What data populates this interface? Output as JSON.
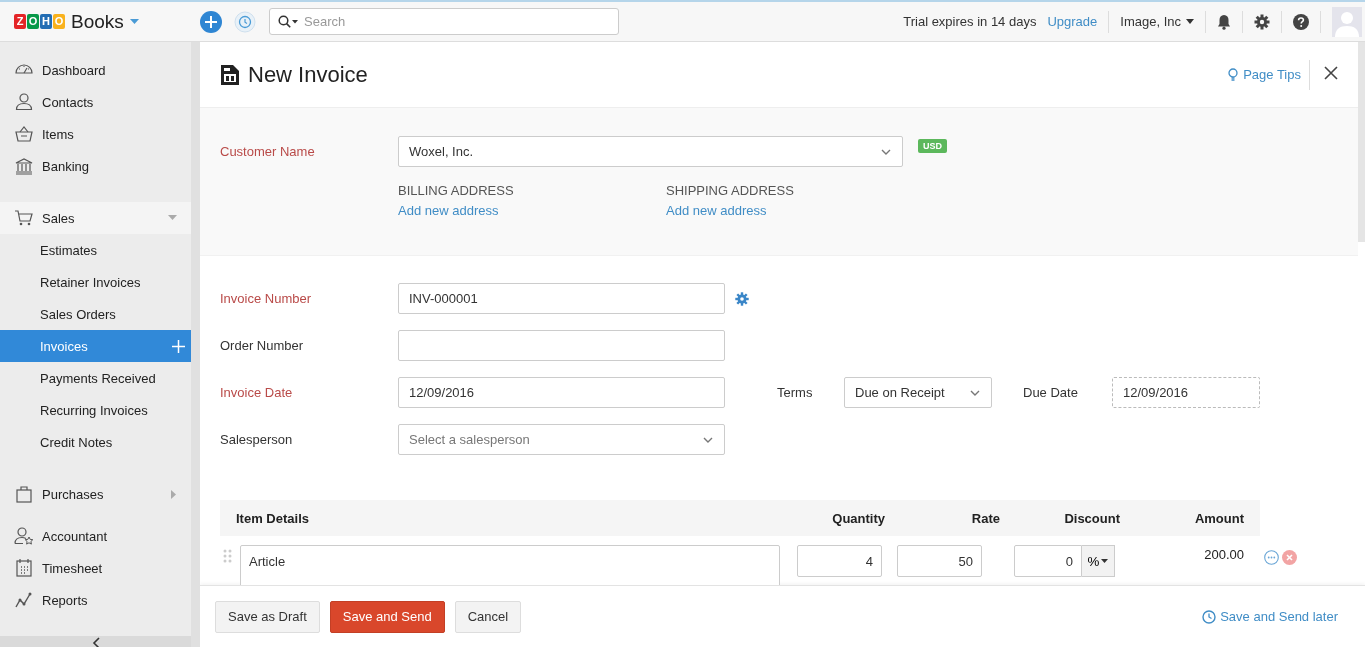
{
  "topbar": {
    "logo": [
      {
        "letter": "Z",
        "color": "#e42527"
      },
      {
        "letter": "O",
        "color": "#089949"
      },
      {
        "letter": "H",
        "color": "#226db4"
      },
      {
        "letter": "O",
        "color": "#f9b21d"
      }
    ],
    "product": "Books",
    "search": {
      "placeholder": "Search"
    },
    "trial": "Trial expires in 14 days",
    "upgrade": "Upgrade",
    "org": "Image, Inc"
  },
  "sidebar": {
    "sections": [
      {
        "items": [
          {
            "label": "Dashboard"
          },
          {
            "label": "Contacts"
          },
          {
            "label": "Items"
          },
          {
            "label": "Banking"
          }
        ]
      },
      {
        "items": [
          {
            "label": "Sales",
            "expanded": true,
            "children": [
              {
                "label": "Estimates",
                "selected": false
              },
              {
                "label": "Retainer Invoices",
                "selected": false
              },
              {
                "label": "Sales Orders",
                "selected": false
              },
              {
                "label": "Invoices",
                "selected": true
              },
              {
                "label": "Payments Received",
                "selected": false
              },
              {
                "label": "Recurring Invoices",
                "selected": false
              },
              {
                "label": "Credit Notes",
                "selected": false
              }
            ]
          }
        ]
      },
      {
        "items": [
          {
            "label": "Purchases",
            "expanded": false
          }
        ]
      },
      {
        "items": [
          {
            "label": "Accountant"
          },
          {
            "label": "Timesheet"
          },
          {
            "label": "Reports"
          }
        ]
      }
    ]
  },
  "page": {
    "title": "New Invoice",
    "tips": "Page Tips"
  },
  "customer": {
    "label": "Customer Name",
    "required": true,
    "value": "Woxel, Inc.",
    "currency": "USD",
    "addresses": [
      {
        "heading": "BILLING ADDRESS",
        "link": "Add new address"
      },
      {
        "heading": "SHIPPING ADDRESS",
        "link": "Add new address"
      }
    ]
  },
  "fields": [
    {
      "label": "Invoice Number",
      "required": true,
      "kind": "text",
      "value": "INV-000001",
      "settings": true
    },
    {
      "label": "Order Number",
      "required": false,
      "kind": "text"
    },
    {
      "label": "Invoice Date",
      "required": true,
      "kind": "text",
      "value": "12/09/2016",
      "terms": {
        "label": "Terms",
        "value": "Due on Receipt",
        "due_label": "Due Date",
        "due": "12/09/2016"
      }
    },
    {
      "label": "Salesperson",
      "required": false,
      "kind": "select",
      "placeholder": "Select a salesperson"
    }
  ],
  "items_table": {
    "columns": [
      "Item Details",
      "Quantity",
      "Rate",
      "Discount",
      "Amount"
    ],
    "rows": [
      {
        "item": "Article",
        "quantity": "4",
        "rate": "50",
        "discount": "0",
        "discount_unit": "%",
        "amount": "200.00"
      }
    ]
  },
  "footer": {
    "buttons": [
      {
        "label": "Save as Draft",
        "kind": "default"
      },
      {
        "label": "Save and Send",
        "kind": "primary"
      },
      {
        "label": "Cancel",
        "kind": "default"
      }
    ],
    "later": "Save and Send later"
  }
}
